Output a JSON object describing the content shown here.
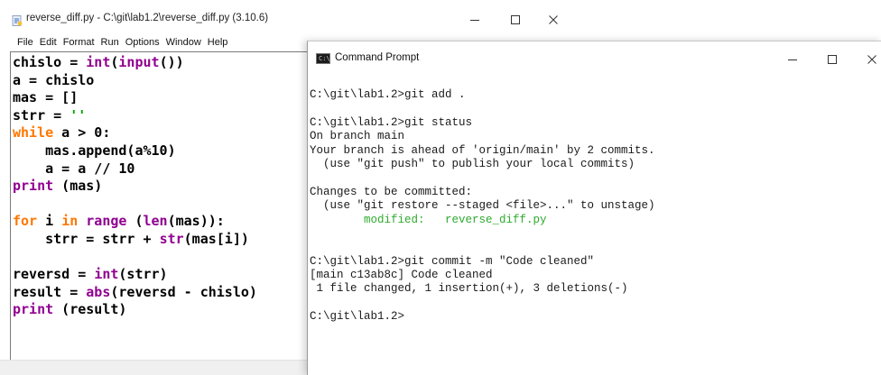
{
  "idle": {
    "title": "reverse_diff.py - C:\\git\\lab1.2\\reverse_diff.py (3.10.6)",
    "menu": [
      "File",
      "Edit",
      "Format",
      "Run",
      "Options",
      "Window",
      "Help"
    ],
    "controls": {
      "minimize": "—",
      "maximize": "☐",
      "close": "✕"
    },
    "code_lines": [
      [
        {
          "t": "chislo = "
        },
        {
          "t": "int",
          "c": "bi"
        },
        {
          "t": "("
        },
        {
          "t": "input",
          "c": "bi"
        },
        {
          "t": "())"
        }
      ],
      [
        {
          "t": "a = chislo"
        }
      ],
      [
        {
          "t": "mas = []"
        }
      ],
      [
        {
          "t": "strr = "
        },
        {
          "t": "''",
          "c": "st"
        }
      ],
      [
        {
          "t": "while",
          "c": "kw"
        },
        {
          "t": " a > 0:"
        }
      ],
      [
        {
          "t": "    mas.append(a%10)"
        }
      ],
      [
        {
          "t": "    a = a // 10"
        }
      ],
      [
        {
          "t": "print",
          "c": "bi"
        },
        {
          "t": " (mas)"
        }
      ],
      [
        {
          "t": ""
        }
      ],
      [
        {
          "t": "for",
          "c": "kw"
        },
        {
          "t": " i "
        },
        {
          "t": "in",
          "c": "kw"
        },
        {
          "t": " "
        },
        {
          "t": "range",
          "c": "bi"
        },
        {
          "t": " ("
        },
        {
          "t": "len",
          "c": "bi"
        },
        {
          "t": "(mas)):"
        }
      ],
      [
        {
          "t": "    strr = strr + "
        },
        {
          "t": "str",
          "c": "bi"
        },
        {
          "t": "(mas[i])"
        }
      ],
      [
        {
          "t": ""
        }
      ],
      [
        {
          "t": "reversd = "
        },
        {
          "t": "int",
          "c": "bi"
        },
        {
          "t": "(strr)"
        }
      ],
      [
        {
          "t": "result = "
        },
        {
          "t": "abs",
          "c": "bi"
        },
        {
          "t": "(reversd - chislo)"
        }
      ],
      [
        {
          "t": "print",
          "c": "bi"
        },
        {
          "t": " (result)"
        }
      ]
    ]
  },
  "cmd": {
    "title": "Command Prompt",
    "icon_text": "C:\\",
    "controls": {
      "minimize": "—",
      "maximize": "☐",
      "close": "✕"
    },
    "lines": [
      {
        "t": "C:\\git\\lab1.2>git add ."
      },
      {
        "t": ""
      },
      {
        "t": "C:\\git\\lab1.2>git status"
      },
      {
        "t": "On branch main"
      },
      {
        "t": "Your branch is ahead of 'origin/main' by 2 commits."
      },
      {
        "t": "  (use \"git push\" to publish your local commits)"
      },
      {
        "t": ""
      },
      {
        "t": "Changes to be committed:"
      },
      {
        "t": "  (use \"git restore --staged <file>...\" to unstage)"
      },
      {
        "t": "        modified:   reverse_diff.py",
        "c": "green"
      },
      {
        "t": ""
      },
      {
        "t": ""
      },
      {
        "t": "C:\\git\\lab1.2>git commit -m \"Code cleaned\""
      },
      {
        "t": "[main c13ab8c] Code cleaned"
      },
      {
        "t": " 1 file changed, 1 insertion(+), 3 deletions(-)"
      },
      {
        "t": ""
      },
      {
        "t": "C:\\git\\lab1.2>"
      }
    ]
  }
}
